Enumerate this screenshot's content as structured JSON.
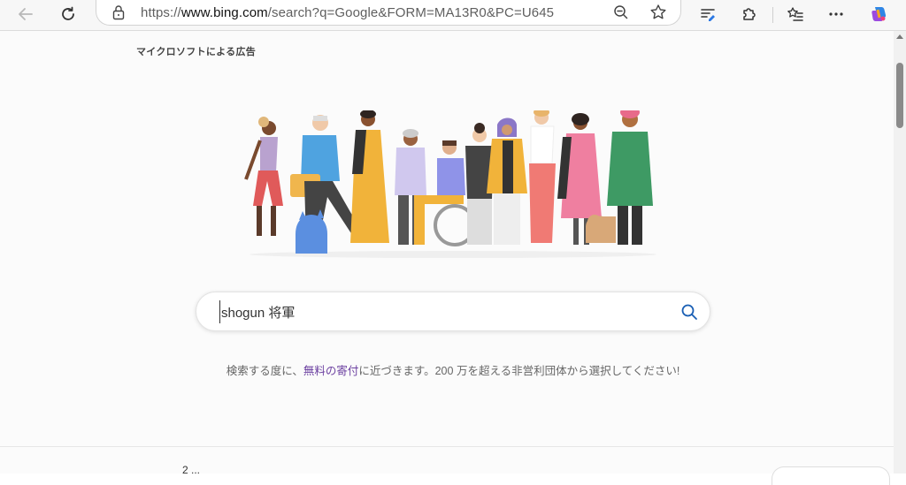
{
  "browser": {
    "url_prefix": "https://",
    "url_host": "www.bing.com",
    "url_path": "/search?q=Google&FORM=MA13R0&PC=U645",
    "icons": {
      "back": "back-arrow-icon",
      "refresh": "refresh-icon",
      "lock": "lock-icon",
      "zoom": "zoom-out-icon",
      "favorite": "star-icon",
      "reading": "reading-view-icon",
      "extensions": "puzzle-extensions-icon",
      "favorites_bar": "favorites-list-icon",
      "more": "more-dots-icon",
      "copilot": "copilot-icon"
    }
  },
  "page": {
    "ad_label": "マイクロソフトによる広告",
    "illustration_alt": "diverse-people-illustration",
    "search": {
      "value": "shogun 将軍",
      "icon": "search-icon"
    },
    "tagline_before": "検索する度に、",
    "tagline_link": "無料の寄付",
    "tagline_after": "に近づきます。200 万を超える非営利団体から選択してください!",
    "bottom_fragment": "2 ...",
    "colors": {
      "link": "#6b3fa0",
      "search_icon": "#1a5fb4"
    }
  }
}
